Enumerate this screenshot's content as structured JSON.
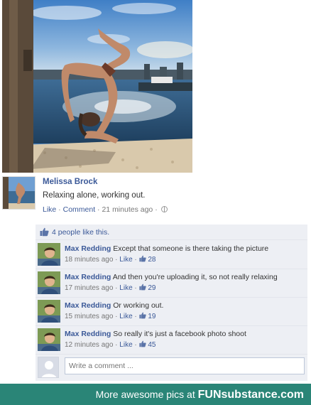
{
  "post": {
    "author": "Melissa Brock",
    "text": "Relaxing alone, working out.",
    "like_label": "Like",
    "comment_label": "Comment",
    "time": "21 minutes ago",
    "sep": " · "
  },
  "likes": {
    "text": "4 people like this."
  },
  "comments": [
    {
      "author": "Max Redding",
      "text": "Except that someone is there taking the picture",
      "time": "18 minutes ago",
      "like_label": "Like",
      "like_count": "28"
    },
    {
      "author": "Max Redding",
      "text": "And then you're uploading it, so not really relaxing",
      "time": "17 minutes ago",
      "like_label": "Like",
      "like_count": "29"
    },
    {
      "author": "Max Redding",
      "text": "Or working out.",
      "time": "15 minutes ago",
      "like_label": "Like",
      "like_count": "19"
    },
    {
      "author": "Max Redding",
      "text": "So really it's just a facebook photo shoot",
      "time": "12 minutes ago",
      "like_label": "Like",
      "like_count": "45"
    }
  ],
  "write_comment": {
    "placeholder": "Write a comment ..."
  },
  "footer": {
    "prefix": "More awesome pics at ",
    "brand": "FUNsubstance.com"
  },
  "colors": {
    "link": "#3b5998",
    "comment_bg": "#edeff4",
    "footer_bg": "#2a8577"
  }
}
